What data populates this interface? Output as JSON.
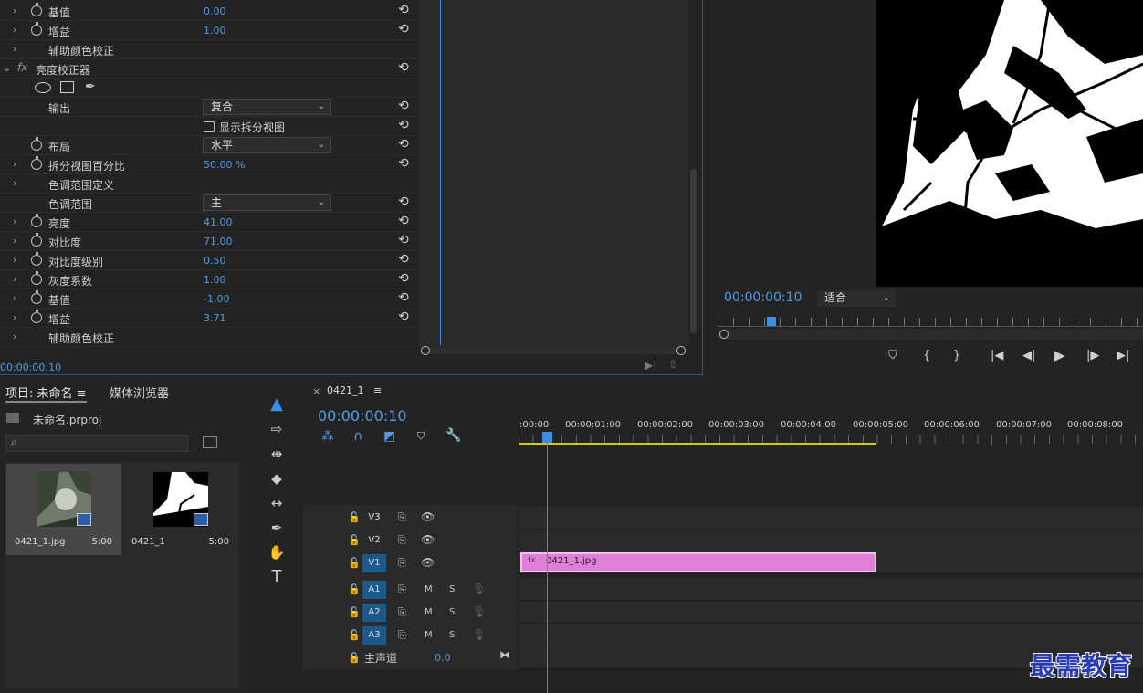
{
  "effect_controls": {
    "rows": [
      {
        "twirl": "›",
        "stopwatch": true,
        "label": "基值",
        "value": "0.00",
        "reset": true
      },
      {
        "twirl": "›",
        "stopwatch": true,
        "label": "增益",
        "value": "1.00",
        "reset": true
      },
      {
        "twirl": "›",
        "stopwatch": false,
        "label": "辅助颜色校正",
        "value": "",
        "reset": false
      },
      {
        "effect_header": true,
        "label": "亮度校正器",
        "fx": "fx",
        "reset": true
      },
      {
        "masks": true
      },
      {
        "label": "输出",
        "dropdown": "复合",
        "reset": true
      },
      {
        "checkbox_label": "显示拆分视图",
        "reset": true
      },
      {
        "stopwatch": true,
        "label": "布局",
        "dropdown": "水平",
        "reset": true
      },
      {
        "twirl": "›",
        "stopwatch": true,
        "label": "拆分视图百分比",
        "value": "50.00 %",
        "reset": true
      },
      {
        "twirl": "›",
        "label": "色调范围定义",
        "reset": false
      },
      {
        "label": "色调范围",
        "dropdown": "主",
        "reset": true
      },
      {
        "twirl": "›",
        "stopwatch": true,
        "label": "亮度",
        "value": "41.00",
        "reset": true
      },
      {
        "twirl": "›",
        "stopwatch": true,
        "label": "对比度",
        "value": "71.00",
        "reset": true
      },
      {
        "twirl": "›",
        "stopwatch": true,
        "label": "对比度级别",
        "value": "0.50",
        "reset": true
      },
      {
        "twirl": "›",
        "stopwatch": true,
        "label": "灰度系数",
        "value": "1.00",
        "reset": true
      },
      {
        "twirl": "›",
        "stopwatch": true,
        "label": "基值",
        "value": "-1.00",
        "reset": true
      },
      {
        "twirl": "›",
        "stopwatch": true,
        "label": "增益",
        "value": "3.71",
        "reset": true
      },
      {
        "twirl": "›",
        "label": "辅助颜色校正",
        "reset": false
      }
    ],
    "timecode": "00:00:00:10"
  },
  "program_monitor": {
    "timecode": "00:00:00:10",
    "fit_label": "适合"
  },
  "project": {
    "tab_project": "项目: 未命名",
    "tab_media": "媒体浏览器",
    "file_name": "未命名.prproj",
    "items": [
      {
        "name": "0421_1.jpg",
        "duration": "5:00"
      },
      {
        "name": "0421_1",
        "duration": "5:00"
      }
    ]
  },
  "timeline": {
    "sequence_tab": "0421_1",
    "timecode": "00:00:00:10",
    "ruler": [
      ":00:00",
      "00:00:01:00",
      "00:00:02:00",
      "00:00:03:00",
      "00:00:04:00",
      "00:00:05:00",
      "00:00:06:00",
      "00:00:07:00",
      "00:00:08:00"
    ],
    "video_tracks": [
      "V3",
      "V2",
      "V1"
    ],
    "audio_tracks": [
      "A1",
      "A2",
      "A3"
    ],
    "master_label": "主声道",
    "master_value": "0.0",
    "clip_name": "0421_1.jpg",
    "clip_fx": "fx",
    "mute": "M",
    "solo": "S"
  },
  "watermark": "最需教育",
  "colors": {
    "accent": "#4d9be6",
    "clip": "#e07fd8",
    "track_on": "#1b5a8a"
  }
}
